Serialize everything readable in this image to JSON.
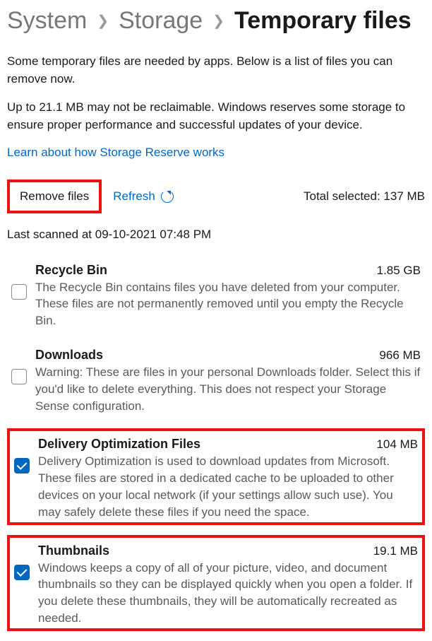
{
  "breadcrumb": {
    "system": "System",
    "storage": "Storage",
    "current": "Temporary files"
  },
  "intro": {
    "p1": "Some temporary files are needed by apps. Below is a list of files you can remove now.",
    "p2": "Up to 21.1 MB may not be reclaimable. Windows reserves some storage to ensure proper performance and successful updates of your device.",
    "link": "Learn about how Storage Reserve works"
  },
  "actions": {
    "remove_label": "Remove files",
    "refresh_label": "Refresh",
    "total_selected_prefix": "Total selected: ",
    "total_selected_value": "137 MB"
  },
  "last_scanned": "Last scanned at 09-10-2021 07:48 PM",
  "items": [
    {
      "title": "Recycle Bin",
      "size": "1.85 GB",
      "desc": "The Recycle Bin contains files you have deleted from your computer. These files are not permanently removed until you empty the Recycle Bin.",
      "checked": false,
      "highlight": false
    },
    {
      "title": "Downloads",
      "size": "966 MB",
      "desc": "Warning: These are files in your personal Downloads folder. Select this if you'd like to delete everything. This does not respect your Storage Sense configuration.",
      "checked": false,
      "highlight": false
    },
    {
      "title": "Delivery Optimization Files",
      "size": "104 MB",
      "desc": "Delivery Optimization is used to download updates from Microsoft. These files are stored in a dedicated cache to be uploaded to other devices on your local network (if your settings allow such use). You may safely delete these files if you need the space.",
      "checked": true,
      "highlight": true
    },
    {
      "title": "Thumbnails",
      "size": "19.1 MB",
      "desc": "Windows keeps a copy of all of your picture, video, and document thumbnails so they can be displayed quickly when you open a folder. If you delete these thumbnails, they will be automatically recreated as needed.",
      "checked": true,
      "highlight": true
    }
  ]
}
